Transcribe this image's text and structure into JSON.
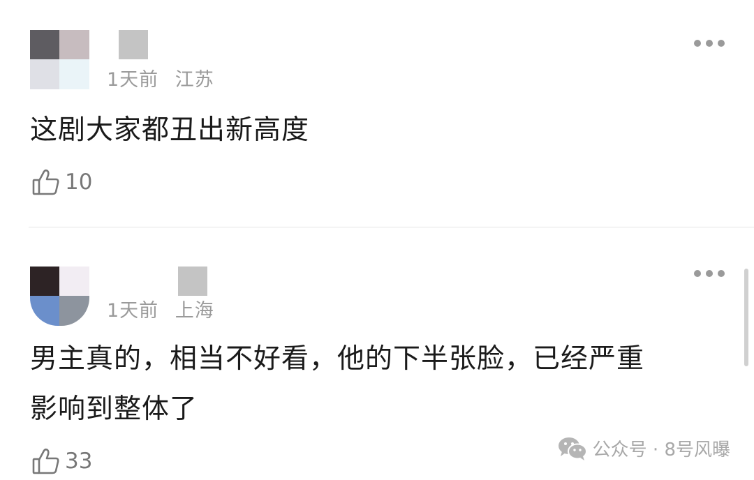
{
  "comments": [
    {
      "time": "1天前",
      "location": "江苏",
      "text": "这剧大家都丑出新高度",
      "likes": "10",
      "avatar_colors": [
        "#5e5c61",
        "#c7bcbf",
        "#dfe0e6",
        "#eaf4f8"
      ]
    },
    {
      "time": "1天前",
      "location": "上海",
      "text": "男主真的，相当不好看，他的下半张脸，已经严重\n影响到整体了",
      "likes": "33",
      "avatar_colors": [
        "#2d2325",
        "#f2edf3",
        "#6b8fcb",
        "#8d949e"
      ]
    }
  ],
  "watermark": {
    "text": "公众号 · 8号风曝",
    "icon": "wechat-icon"
  },
  "colors": {
    "meta": "#9a9a9a",
    "text": "#1a1a1a",
    "divider": "#e5e5e5"
  }
}
